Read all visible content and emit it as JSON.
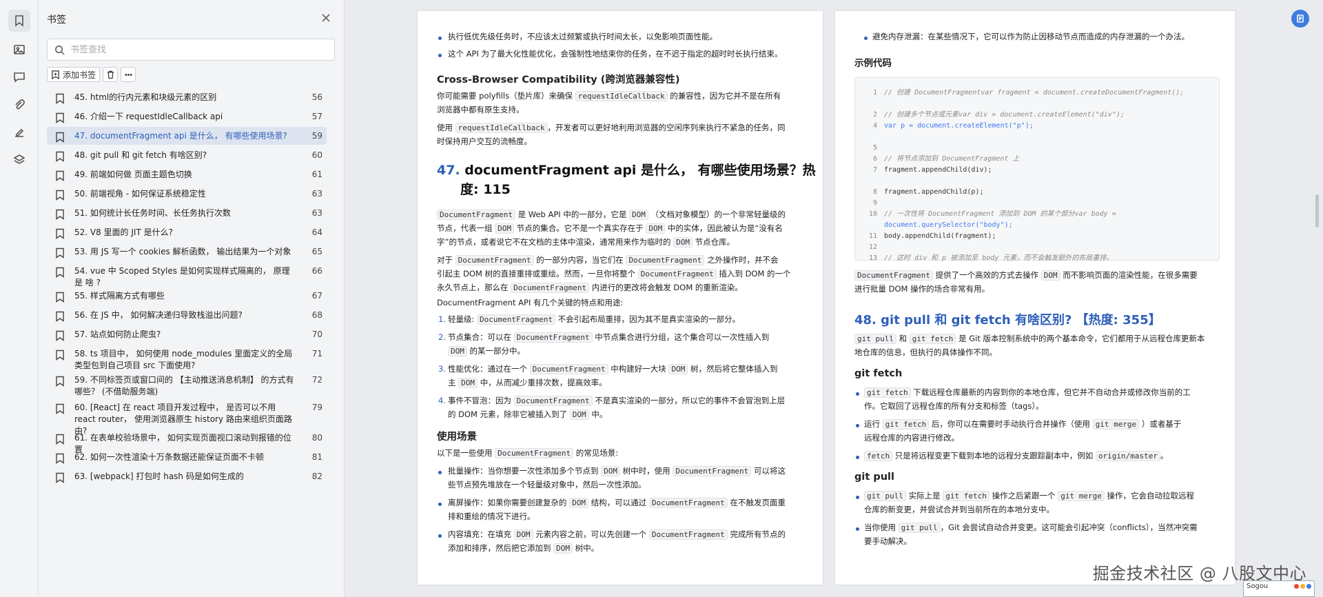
{
  "rail": {
    "icons": [
      "bookmark-icon",
      "image-icon",
      "comment-icon",
      "attachment-icon",
      "signature-icon",
      "layers-icon"
    ]
  },
  "panel": {
    "title": "书签",
    "search_placeholder": "书签查找",
    "add_label": "添加书签",
    "items": [
      {
        "label": "45. html的行内元素和块级元素的区别",
        "page": "56"
      },
      {
        "label": "46. 介绍一下 requestIdleCallback api",
        "page": "57"
      },
      {
        "label": "47. documentFragment api 是什么， 有哪些使用场景?",
        "page": "59"
      },
      {
        "label": "48. git pull 和 git fetch 有啥区别?",
        "page": "60"
      },
      {
        "label": "49. 前端如何做 页面主题色切换",
        "page": "61"
      },
      {
        "label": "50. 前端视角 - 如何保证系统稳定性",
        "page": "63"
      },
      {
        "label": "51. 如何统计长任务时间、长任务执行次数",
        "page": "63"
      },
      {
        "label": "52. V8 里面的 JIT 是什么?",
        "page": "64"
      },
      {
        "label": "53. 用 JS 写一个 cookies 解析函数， 输出结果为一个对象",
        "page": "65"
      },
      {
        "label": "54. vue 中 Scoped Styles 是如何实现样式隔离的， 原理是 啥 ?",
        "page": "66"
      },
      {
        "label": "55. 样式隔离方式有哪些",
        "page": "67"
      },
      {
        "label": "56. 在 JS 中， 如何解决递归导致栈溢出问题?",
        "page": "68"
      },
      {
        "label": "57. 站点如何防止爬虫?",
        "page": "70"
      },
      {
        "label": "58. ts 项目中， 如何使用 node_modules 里面定义的全局类型包到自己项目 src 下面使用?",
        "page": "71"
      },
      {
        "label": "59. 不同标签页或窗口间的 【主动推送消息机制】 的方式有哪些？ (不借助服务端)",
        "page": "72"
      },
      {
        "label": "60. [React] 在 react 项目开发过程中， 是否可以不用 react router， 使用浏览器原生 history 路由来组织页面路由?",
        "page": "79"
      },
      {
        "label": "61. 在表单校验场景中， 如何实现页面视口滚动到报错的位置",
        "page": "80"
      },
      {
        "label": "62. 如何一次性渲染十万条数据还能保证页面不卡顿",
        "page": "81"
      },
      {
        "label": "63. [webpack] 打包时 hash 码是如何生成的",
        "page": "82"
      }
    ]
  },
  "page1": {
    "b1": "执行低优先级任务时，不应该太过频繁或执行时间太长，以免影响页面性能。",
    "b2": "这个 API 为了最大化性能优化，会强制性地结束你的任务，在不迟于指定的超时时长执行结束。",
    "h_compat": "Cross-Browser Compatibility (跨浏览器兼容性)",
    "p1a": "你可能需要 polyfills（垫片库）来确保",
    "p1code": "requestIdleCallback",
    "p1b": "的兼容性，因为它并不是在所有",
    "p1c": "浏览器中都有原生支持。",
    "p2a": "使用",
    "p2code": "requestIdleCallback",
    "p2b": "，开发者可以更好地利用浏览器的空闲序列来执行不紧急的任务，同",
    "p2c": "时保持用户交互的流畅度。",
    "h47_num": "47.",
    "h47_l1": "documentFragment api 是什么， 有哪些使用场景？热",
    "h47_l2": "度: 115",
    "code_df": "DocumentFragment",
    "code_dom": "DOM",
    "p3a": "是 Web API 中的一部分，它是",
    "p3b": "（文档对象模型）的一个非常轻量级的",
    "p3c": "节点，代表一组",
    "p3d": "节点的集合。它不是一个真实存在于",
    "p3e": "中的实体，因此被认为是“没有名",
    "p3f": "字”的节点，或者说它不在文档的主体中渲染，通常用来作为临时的",
    "p3g": "节点仓库。",
    "p4a": "对于",
    "p4b": "的一部分内容，当它们在",
    "p4c": "之外操作时，并不会",
    "p4d": "引起主 DOM 树的直接重排或重绘。然而，一旦你将整个",
    "p4e": "插入到 DOM 的一个",
    "p4f": "永久节点上，那么在",
    "p4g": "内进行的更改将会触发 DOM 的重新渲染。",
    "p5": "DocumentFragment API 有几个关键的特点和用途:",
    "o1a": "轻量级:",
    "o1b": "不会引起布局重排，因为其不是真实渲染的一部分。",
    "o2a": "节点集合：可以在",
    "o2b": "中节点集合进行分组，这个集合可以一次性插入到",
    "o2c": "的某一部分中。",
    "o3a": "性能优化：通过在一个",
    "o3b": "中构建好一大块",
    "o3c": "树，然后将它整体插入到",
    "o3d": "主",
    "o3e": "中，从而减少重排次数，提高效率。",
    "o4a": "事件不冒泡：因为",
    "o4b": "不是真实渲染的一部分，所以它的事件不会冒泡到上层",
    "o4c": "的 DOM 元素，除非它被插入到了",
    "o4d": "中。",
    "h_use": "使用场景",
    "p6a": "以下是一些使用",
    "p6b": "的常见场景:",
    "u1a": "批量操作：当你想要一次性添加多个节点到",
    "u1b": "树中时，使用",
    "u1c": "可以将这",
    "u1d": "些节点预先堆放在一个轻量级对象中，然后一次性添加。",
    "u2a": "离屏操作：如果你需要创建复杂的",
    "u2b": "结构，可以通过",
    "u2c": "在不触发页面重",
    "u2d": "排和重绘的情况下进行。",
    "u3a": "内容填充：在填充",
    "u3b": "元素内容之前，可以先创建一个",
    "u3c": "完成所有节点的",
    "u3d": "添加和排序，然后把它添加到",
    "u3e": "树中。"
  },
  "page2": {
    "b1": "避免内存泄漏：在某些情况下，它可以作为防止因移动节点而造成的内存泄漏的一个办法。",
    "h_example": "示例代码",
    "code_lines": [
      {
        "n": "1",
        "t": "// 创建 DocumentFragmentvar fragment = document.createDocumentFragment();"
      },
      {
        "n": "2",
        "t": "// 创建多个节点或元素var div = document.createElement(\"div\");"
      },
      {
        "n": "4",
        "t": "var p = document.createElement(\"p\");"
      },
      {
        "n": "5",
        "t": ""
      },
      {
        "n": "6",
        "t": "// 将节点添加到 DocumentFragment 上"
      },
      {
        "n": "7",
        "t": "fragment.appendChild(div);"
      },
      {
        "n": "8",
        "t": "fragment.appendChild(p);"
      },
      {
        "n": "9",
        "t": ""
      },
      {
        "n": "10",
        "t": "// 一次性将 DocumentFragment 添加到 DOM 的某个部分var body ="
      },
      {
        "n": "",
        "t": "document.querySelector(\"body\");"
      },
      {
        "n": "11",
        "t": "body.appendChild(fragment);"
      },
      {
        "n": "12",
        "t": ""
      },
      {
        "n": "13",
        "t": "// 这时 div 和 p 被添加至 body 元素，而不会触发额外的布局重排。"
      }
    ],
    "p1a": "提供了一个高效的方式去操作",
    "p1b": "而不影响页面的渲染性能，在很多需要",
    "p1c": "进行批量 DOM 操作的场合非常有用。",
    "h48": "48. git pull 和 git fetch 有啥区别? 【热度: 355】",
    "c_gitpull": "git pull",
    "c_gitfetch": "git fetch",
    "c_gitmerge": "git merge",
    "c_fetch": "fetch",
    "c_origin": "origin/master",
    "p2a": "和",
    "p2b": "是 Git 版本控制系统中的两个基本命令，它们都用于从远程仓库更新本",
    "p2c": "地仓库的信息，但执行的具体操作不同。",
    "h_fetch": "git fetch",
    "f1a": "下载远程仓库最新的内容到你的本地仓库，但它并不自动合并或修改你当前的工",
    "f1b": "作。它取回了远程仓库的所有分支和标签（tags）。",
    "f2a": "运行",
    "f2b": "后，你可以在需要时手动执行合并操作（使用",
    "f2c": "）或者基于",
    "f2d": "远程仓库的内容进行修改。",
    "f3a": "只是将远程变更下载到本地的远程分支跟踪副本中，例如",
    "f3b": "。",
    "h_pull": "git pull",
    "g1a": "实际上是",
    "g1b": "操作之后紧跟一个",
    "g1c": "操作，它会自动拉取远程",
    "g1d": "仓库的新变更，并尝试合并到当前所在的本地分支中。",
    "g2a": "当你使用",
    "g2b": "，Git 会尝试自动合并变更。这可能会引起冲突（conflicts），当然冲突需",
    "g2c": "要手动解决。"
  },
  "watermark": "掘金技术社区 @ 八股文中心",
  "ime_label": "Sogou"
}
